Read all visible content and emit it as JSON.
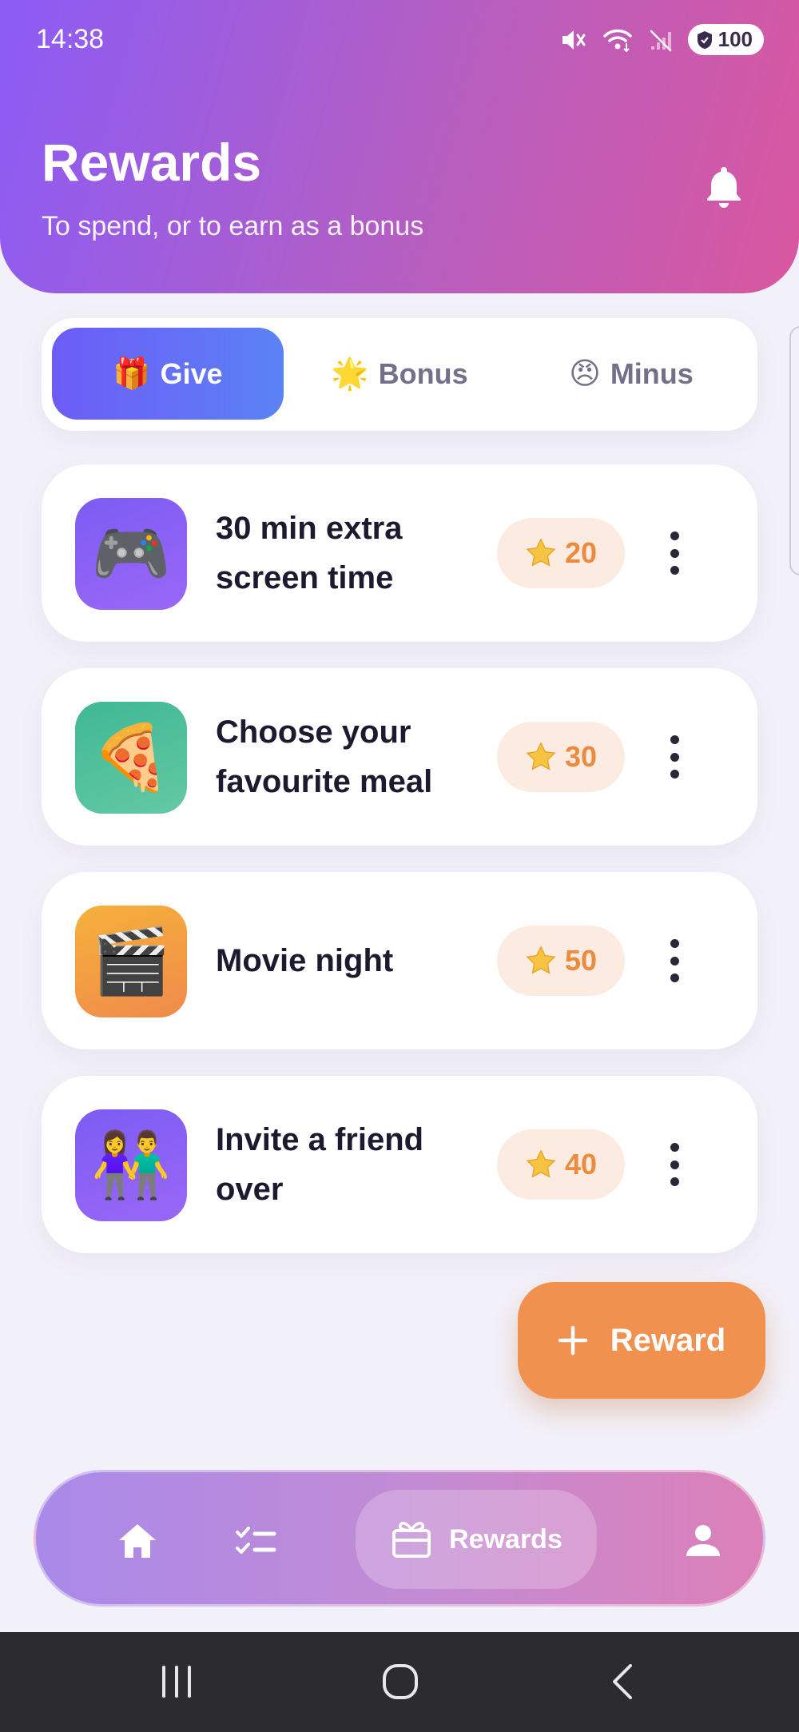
{
  "status_bar": {
    "time": "14:38",
    "battery": "100",
    "icons": [
      "mute-icon",
      "wifi-icon",
      "no-signal-icon",
      "battery-icon"
    ]
  },
  "header": {
    "title": "Rewards",
    "subtitle": "To spend, or to earn as a bonus",
    "icon": "bell-icon"
  },
  "tabs": [
    {
      "emoji": "🎁",
      "label": "Give",
      "active": true
    },
    {
      "emoji": "🌟",
      "label": "Bonus",
      "active": false
    },
    {
      "emoji": "😠",
      "label": "Minus",
      "active": false
    }
  ],
  "rewards": [
    {
      "emoji": "🎮",
      "title": "30 min extra screen time",
      "points": "20",
      "icon_gradient": [
        "#7c5cf4",
        "#9a67f6"
      ]
    },
    {
      "emoji": "🍕",
      "title": "Choose your favourite meal",
      "points": "30",
      "icon_gradient": [
        "#3fb894",
        "#63c9a3"
      ]
    },
    {
      "emoji": "🎬",
      "title": "Movie night",
      "points": "50",
      "icon_gradient": [
        "#f6b13a",
        "#f08a4b"
      ]
    },
    {
      "emoji": "👫",
      "title": "Invite a friend over",
      "points": "40",
      "icon_gradient": [
        "#7c5cf4",
        "#9a67f6"
      ]
    }
  ],
  "fab": {
    "label": "Reward"
  },
  "bottom_nav": {
    "items": [
      {
        "icon": "home-icon",
        "label": ""
      },
      {
        "icon": "checklist-icon",
        "label": ""
      },
      {
        "icon": "gift-box-icon",
        "label": "Rewards",
        "active": true
      },
      {
        "icon": "profile-icon",
        "label": ""
      }
    ]
  },
  "colors": {
    "accent": "#6d5cf6",
    "points_text": "#ec8a3e",
    "points_bg": "#fcebe0",
    "fab": "#f09150"
  }
}
